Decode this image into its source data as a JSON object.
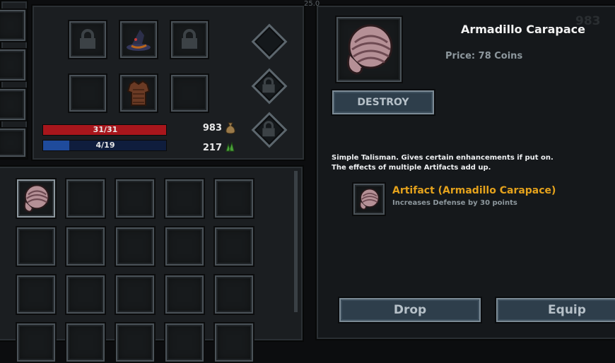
{
  "equipment": {
    "hp": {
      "current": 31,
      "max": 31,
      "label": "31/31"
    },
    "mana": {
      "current": 4,
      "max": 19,
      "label": "4/19"
    },
    "coins": "983",
    "gems": "217",
    "top_counter": "983",
    "top_label": "25.0"
  },
  "item_detail": {
    "title": "Armadillo Carapace",
    "price": "Price: 78 Coins",
    "destroy_label": "DESTROY",
    "description_line1": "Simple Talisman. Gives certain enhancements if put on.",
    "description_line2": "The effects of multiple Artifacts add up.",
    "artifact_name": "Artifact (Armadillo Carapace)",
    "artifact_effect": "Increases Defense by 30 points",
    "drop_label": "Drop",
    "equip_label": "Equip"
  },
  "colors": {
    "hp_bar": "#a8161c",
    "mana_bar": "#1f4b9c",
    "artifact_name": "#e4a21c"
  },
  "icons": [
    "lock-icon",
    "wizard-hat-icon",
    "leather-armor-icon",
    "armadillo-shell-icon",
    "coin-bag-icon",
    "gem-cluster-icon",
    "pentagram-icon"
  ]
}
